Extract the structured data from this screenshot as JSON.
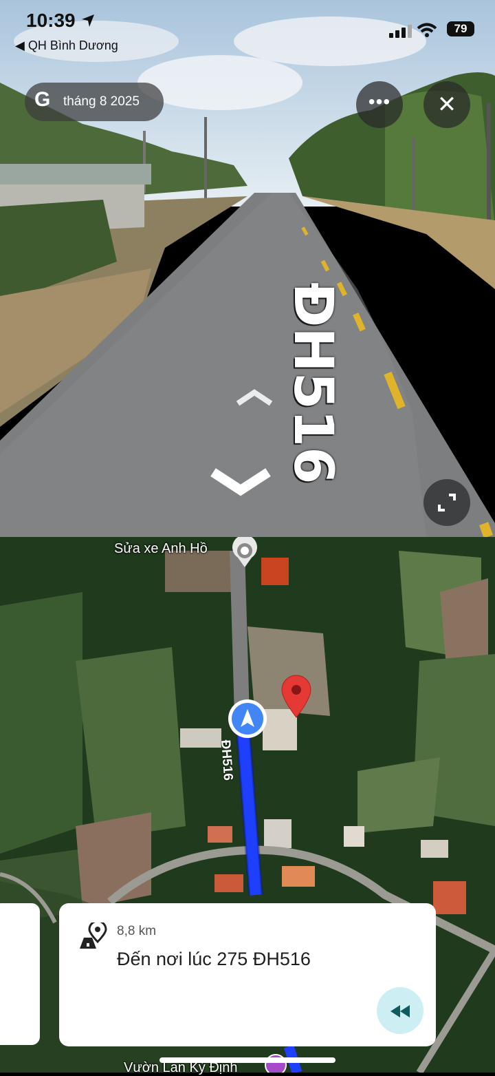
{
  "status_bar": {
    "time": "10:39",
    "back_app": "◀ QH Bình Dương",
    "battery": "79"
  },
  "street_view": {
    "date_pill": {
      "logo": "G",
      "label": "tháng 8 2025"
    },
    "road_marking": "ĐH516",
    "icons": [
      "more-icon",
      "close-icon",
      "expand-icon",
      "nav-up-chevron",
      "nav-down-chevron"
    ]
  },
  "map": {
    "place_top": "Sửa xe Anh Hồ",
    "road_label": "ĐH516",
    "place_bottom": "Vườn Lan Kỳ Định",
    "route_color": "#1f3fff",
    "pin_color": "#e53935",
    "location_color": "#4285f4"
  },
  "nav_card": {
    "distance": "8,8 km",
    "destination": "Đến nơi lúc 275 ĐH516",
    "rewind_icon": "rewind-icon"
  }
}
